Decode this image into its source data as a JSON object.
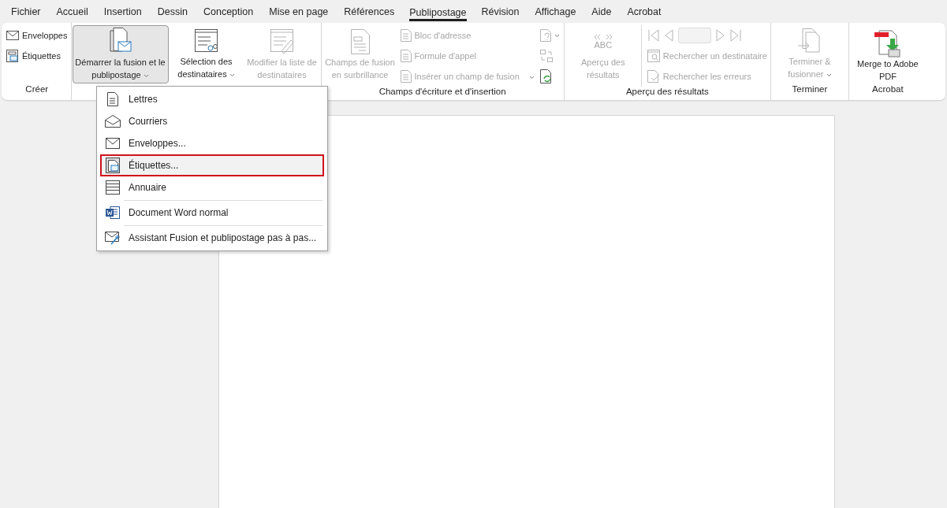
{
  "menu_bar": [
    {
      "label": "Fichier",
      "selected": false
    },
    {
      "label": "Accueil",
      "selected": false
    },
    {
      "label": "Insertion",
      "selected": false
    },
    {
      "label": "Dessin",
      "selected": false
    },
    {
      "label": "Conception",
      "selected": false
    },
    {
      "label": "Mise en page",
      "selected": false
    },
    {
      "label": "Références",
      "selected": false
    },
    {
      "label": "Publipostage",
      "selected": true
    },
    {
      "label": "Révision",
      "selected": false
    },
    {
      "label": "Affichage",
      "selected": false
    },
    {
      "label": "Aide",
      "selected": false
    },
    {
      "label": "Acrobat",
      "selected": false
    }
  ],
  "ribbon": {
    "groups": [
      {
        "label": "Créer",
        "columns": [
          [
            {
              "kind": "small",
              "label": "Enveloppes",
              "disabled": false
            },
            {
              "kind": "small",
              "label": "Étiquettes",
              "disabled": false
            }
          ]
        ]
      },
      {
        "columns": [
          [
            {
              "kind": "large",
              "label": "Démarrer la fusion et le publipostage",
              "disabled": false,
              "pressed": true,
              "dropdown": true
            }
          ],
          [
            {
              "kind": "large",
              "label": "Sélection des destinataires",
              "disabled": false,
              "pressed": false,
              "dropdown": true
            }
          ],
          [
            {
              "kind": "large",
              "label": "Modifier la liste de destinataires",
              "disabled": true,
              "pressed": false,
              "dropdown": false
            }
          ]
        ]
      },
      {
        "label": "Champs d'écriture et d'insertion",
        "columns": [
          [
            {
              "kind": "large",
              "label": "Champs de fusion en surbrillance",
              "disabled": true,
              "pressed": false,
              "dropdown": false
            }
          ],
          [
            {
              "kind": "small",
              "label": "Bloc d'adresse",
              "disabled": true
            },
            {
              "kind": "small",
              "label": "Formule d'appel",
              "disabled": true
            },
            {
              "kind": "small",
              "label": "Insérer un champ de fusion",
              "disabled": true,
              "dropdown": true
            }
          ],
          [
            {
              "kind": "icon",
              "disabled": true,
              "dropdown": true
            },
            {
              "kind": "icon",
              "disabled": true
            },
            {
              "kind": "icon",
              "disabled": false
            }
          ]
        ]
      },
      {
        "label": "Aperçu des résultats",
        "columns": [
          [
            {
              "kind": "large",
              "icon_text": "ABC",
              "label": "Aperçu des résultats",
              "disabled": true,
              "pressed": false,
              "dropdown": false
            }
          ],
          [
            {
              "kind": "nav",
              "disabled": true
            },
            {
              "kind": "small",
              "label": "Rechercher un destinataire",
              "disabled": true
            },
            {
              "kind": "small",
              "label": "Rechercher les erreurs",
              "disabled": true
            }
          ]
        ]
      },
      {
        "label": "Terminer",
        "columns": [
          [
            {
              "kind": "large",
              "label": "Terminer & fusionner",
              "disabled": true,
              "pressed": false,
              "dropdown": true
            }
          ]
        ]
      },
      {
        "label": "Acrobat",
        "columns": [
          [
            {
              "kind": "large",
              "label": "Merge to Adobe PDF",
              "disabled": false,
              "pressed": false,
              "dropdown": false
            }
          ]
        ]
      }
    ]
  },
  "dropdown_menu": [
    {
      "label": "Lettres",
      "selected": false,
      "separator_before": false
    },
    {
      "label": "Courriers",
      "selected": false,
      "separator_before": false
    },
    {
      "label": "Enveloppes...",
      "selected": false,
      "separator_before": false
    },
    {
      "label": "Étiquettes...",
      "selected": true,
      "separator_before": false
    },
    {
      "label": "Annuaire",
      "selected": false,
      "separator_before": false
    },
    {
      "label": "Document Word normal",
      "selected": false,
      "separator_before": true
    },
    {
      "label": "Assistant Fusion et publipostage pas à pas...",
      "selected": false,
      "separator_before": true
    }
  ]
}
